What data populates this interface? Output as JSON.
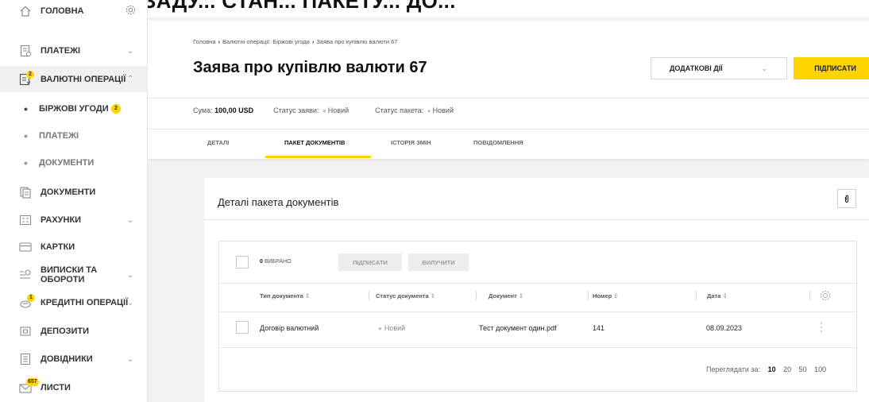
{
  "top_overlay_text": "ДРУЖЕ... ЗАДУ... СТАН... ПАКЕТУ... ДО...",
  "sidebar": {
    "items": [
      {
        "label": "ГОЛОВНА",
        "icon": "home-icon"
      },
      {
        "label": "ПЛАТЕЖІ",
        "icon": "payments-icon"
      },
      {
        "label": "ВАЛЮТНІ ОПЕРАЦІЇ",
        "icon": "currency-icon",
        "badge": "2"
      },
      {
        "label": "ДОКУМЕНТИ",
        "icon": "document-icon"
      },
      {
        "label": "РАХУНКИ",
        "icon": "accounts-icon"
      },
      {
        "label": "КАРТКИ",
        "icon": "card-icon"
      },
      {
        "label": "ВИПИСКИ ТА ОБОРОТИ",
        "icon": "statements-icon"
      },
      {
        "label": "КРЕДИТНІ ОПЕРАЦІЇ",
        "icon": "credit-icon",
        "badge": "1"
      },
      {
        "label": "ДЕПОЗИТИ",
        "icon": "deposit-icon"
      },
      {
        "label": "ДОВІДНИКИ",
        "icon": "directory-icon"
      },
      {
        "label": "ЛИСТИ",
        "icon": "mail-icon",
        "badge": "657"
      }
    ],
    "subitems": [
      {
        "label": "БІРЖОВІ УГОДИ",
        "badge": "2"
      },
      {
        "label": "ПЛАТЕЖІ"
      },
      {
        "label": "ДОКУМЕНТИ"
      }
    ]
  },
  "header": {
    "breadcrumb": [
      "Головна",
      "Валютні операції: Біржові угоди",
      "Заява про купівлю валюти 67"
    ],
    "title": "Заява про купівлю валюти 67",
    "more_actions_label": "ДОДАТКОВІ ДІЇ",
    "sign_label": "ПІДПИСАТИ",
    "summary": {
      "amount_label": "Сума:",
      "amount_value": "100,00 USD",
      "app_status_label": "Статус заяви:",
      "app_status_value": "Новий",
      "package_status_label": "Статус пакета:",
      "package_status_value": "Новий"
    },
    "tabs": [
      "ДЕТАЛІ",
      "ПАКЕТ ДОКУМЕНТІВ",
      "ІСТОРІЯ ЗМІН",
      "ПОВІДОМЛЕННЯ"
    ],
    "active_tab": "ПАКЕТ ДОКУМЕНТІВ"
  },
  "package": {
    "title": "Деталі пакета документів",
    "selected_count": "0",
    "selected_label": "ВИБРАНО",
    "sign_button": "ПІДПИСАТИ",
    "remove_button": "ВИЛУЧИТИ",
    "columns": [
      "Тип документа",
      "Статус документа",
      "Документ",
      "Номер",
      "Дата"
    ],
    "rows": [
      {
        "type": "Договір валютний",
        "status": "Новий",
        "document": "Тест документ один.pdf",
        "number": "141",
        "date": "08.09.2023"
      }
    ],
    "pager_label": "Переглядати за:",
    "page_sizes": [
      "10",
      "20",
      "50",
      "100"
    ],
    "current_page_size": "10"
  },
  "colors": {
    "accent": "#ffd400",
    "background": "#f2f2f2"
  }
}
